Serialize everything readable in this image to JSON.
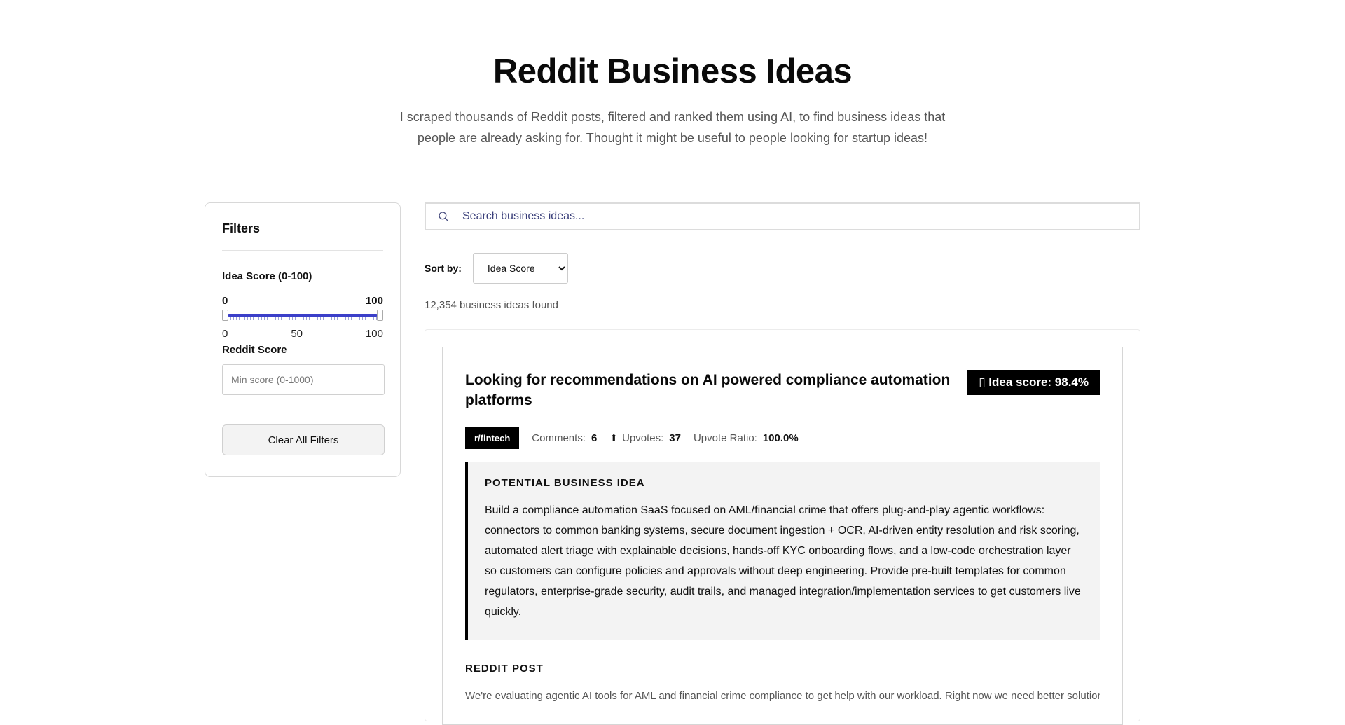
{
  "header": {
    "title": "Reddit Business Ideas",
    "subtitle": "I scraped thousands of Reddit posts, filtered and ranked them using AI, to find business ideas that people are already asking for. Thought it might be useful to people looking for startup ideas!"
  },
  "filters": {
    "heading": "Filters",
    "idea_score_label": "Idea Score (0-100)",
    "range_min_value": "0",
    "range_max_value": "100",
    "scale_min": "0",
    "scale_mid": "50",
    "scale_max": "100",
    "reddit_score_label": "Reddit Score",
    "min_score_placeholder": "Min score (0-1000)",
    "clear_button": "Clear All Filters"
  },
  "search": {
    "placeholder": "Search business ideas...",
    "icon": "search-icon"
  },
  "sort": {
    "label": "Sort by:",
    "selected": "Idea Score"
  },
  "results_count": "12,354 business ideas found",
  "cards": [
    {
      "title": "Looking for recommendations on AI powered compliance automation platforms",
      "score_badge": "▯ Idea score: 98.4%",
      "subreddit": "r/fintech",
      "comments_label": "Comments:",
      "comments": "6",
      "upvote_icon": "⬆",
      "upvotes_label": "Upvotes:",
      "upvotes": "37",
      "ratio_label": "Upvote Ratio:",
      "ratio": "100.0%",
      "idea_heading": "POTENTIAL BUSINESS IDEA",
      "idea_text": "Build a compliance automation SaaS focused on AML/financial crime that offers plug-and-play agentic workflows: connectors to common banking systems, secure document ingestion + OCR, AI-driven entity resolution and risk scoring, automated alert triage with explainable decisions, hands-off KYC onboarding flows, and a low-code orchestration layer so customers can configure policies and approvals without deep engineering. Provide pre-built templates for common regulators, enterprise-grade security, audit trails, and managed integration/implementation services to get customers live quickly.",
      "post_heading": "REDDIT POST",
      "post_text": "We're evaluating agentic AI tools for AML and financial crime compliance to get help with our workload. Right now we need better solutions"
    }
  ],
  "colors": {
    "accent": "#3b3fc9",
    "badge_bg": "#000000",
    "idea_box_bg": "#f3f3f3"
  }
}
